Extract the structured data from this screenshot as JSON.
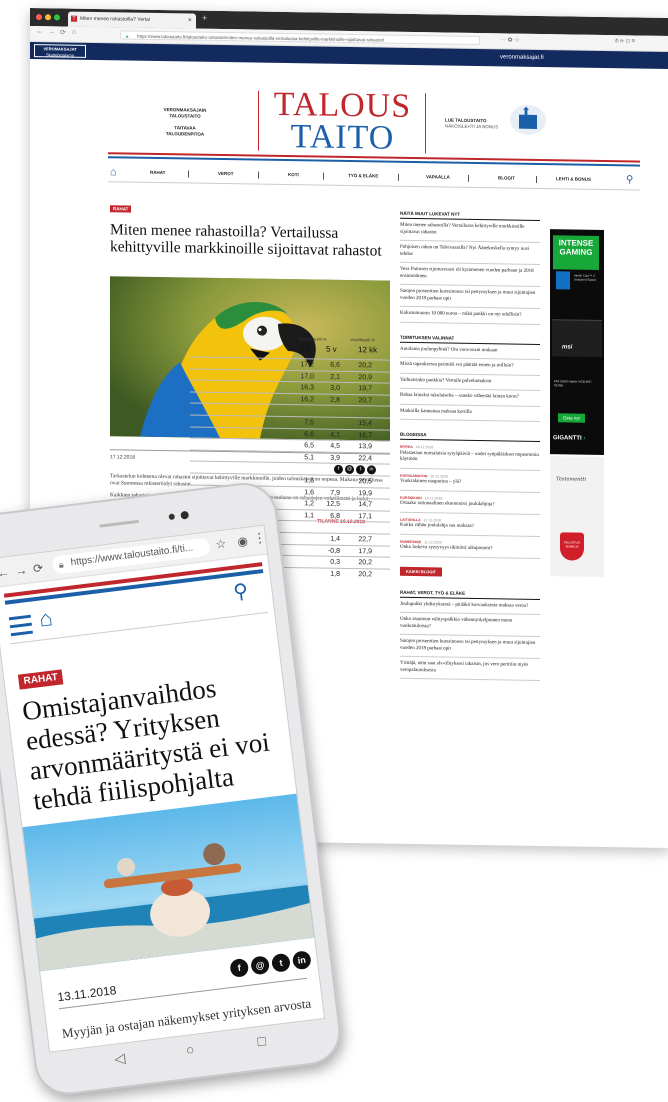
{
  "browser": {
    "tab_title": "Miten menee rahastoilla? Vertai",
    "url": "https://www.taloustaito.fi/taloustaito-rahastot/miten-menee-rahastoilla-vertailussa-kehittyville-markkinoille-sijoittavat-rahastot/",
    "new_tab": "+",
    "url_actions": "··· ✿ ☆",
    "toolbar_right": "⫛ ⊪ ⊡ ≡"
  },
  "site": {
    "topbar_logo_line1": "VEROMAKSAJAT",
    "topbar_logo_line2": "Skattebetalarna",
    "topbar_link": "veronmaksajat.fi",
    "masthead_left": [
      "VERONMAKSAJAIN",
      "TALOUSTAITO",
      "TAITAVAA",
      "TALOUDENPITOA"
    ],
    "logo_line1": "TALOUS",
    "logo_line2": "TAITO",
    "masthead_right_title": "LUE TALOUSTAITO",
    "masthead_right_sub": "NÄKÖISLEHTI JA BONUS",
    "nav": [
      "RAHAT",
      "VEROT",
      "KOTI",
      "TYÖ & ELÄKE",
      "VAPAALLA",
      "BLOGIT",
      "LEHTI & BONUS"
    ]
  },
  "article": {
    "badge": "RAHAT",
    "title": "Miten menee rahastoilla? Vertailussa kehittyville markkinoille sijoittavat rahastot",
    "date": "17.12.2018",
    "lead1": "Tarkastelun kohteena olevat rahastot sijoittavat kehittyville markkinoille, joiden talouskasvu on nopeaa. Mukana vertailussa ovat Suomessa rekisteröidyt rahastot.",
    "lead2": "Kaikkien rahastojen tuotot näkyvät taulukossa samalta aikaväliltä. Lisäksi mukana on rahastojen volatiliteetti ja kulut.",
    "table_heading": "TILANNE 10.12.2018",
    "th_return": "Muutosvauhti %",
    "th_vol": "Volatiliteetti %",
    "cols": [
      "3 v",
      "5 v",
      "12 kk"
    ],
    "rows": [
      [
        "17,2",
        "6,6",
        "20,2"
      ],
      [
        "17,0",
        "2,1",
        "20,9"
      ],
      [
        "16,3",
        "3,0",
        "19,7"
      ],
      [
        "16,2",
        "2,8",
        "20,7"
      ],
      [
        "",
        "",
        ""
      ],
      [
        "7,5",
        "",
        "15,4"
      ],
      [
        "6,6",
        "4,1",
        "16,7"
      ],
      [
        "6,5",
        "4,5",
        "13,9"
      ],
      [
        "5,1",
        "3,9",
        "22,4"
      ],
      [
        "",
        "",
        ""
      ],
      [
        "1,8",
        "",
        "20,5"
      ],
      [
        "1,6",
        "7,9",
        "19,9"
      ],
      [
        "1,2",
        "12,5",
        "14,7"
      ],
      [
        "1,1",
        "6,8",
        "17,1"
      ],
      [
        "",
        "",
        ""
      ],
      [
        "",
        "1,4",
        "22,7"
      ],
      [
        "",
        "-0,8",
        "17,9"
      ],
      [
        "",
        "0,3",
        "20,2"
      ],
      [
        "",
        "1,8",
        "20,2"
      ]
    ]
  },
  "sidebar": {
    "head1": "NÄITÄ MUUT LUKEVAT NYT",
    "most_read": [
      "Miten menee rahastoilla? Vertailussa kehittyville markkinoille sijoittavat rahastot",
      "Pohjoisen rahan on Talvivaaralla? Nyt Äänekoskella syntyy uusi tehdas",
      "Vesa Puttosen sijoitusvuosi oli kymmenen vuoden parhaan ja 2018 ensimmäinen",
      "Satojen prosenttien kurssinousu tai pettymyksen ja muut sijoittajien vuoden 2018 parhaat opit",
      "Kalustomuutto 10 000 euroa – mikä pankki on nyt edullisin?"
    ],
    "head2": "TOIMITUKSEN VALINNAT",
    "picks": [
      "Autolaina joulunpyhinä? Ota vara-avain mukaan",
      "Missä tapauksessa perintöä voi päättää ennen ja milloin?",
      "Vaihtaisinko pankkia? Vertaile palvelumaksut",
      "Rahaa lainaksi tukulaiselta – saanko vähentää lainan korot?",
      "Matkoilla kannattaa maksaa kortilla"
    ],
    "head3": "BLOGEISSA",
    "blogs": [
      {
        "cat": "MYRKA",
        "date": "20.12.2018",
        "title": "Pelastetaan nuosalaisia sytyäpäiviä – uudet syöpäläiskset nopeammin käyttöön"
      },
      {
        "cat": "KORVAAMATON",
        "date": "18.12.2018",
        "title": "Vuokralainen naapurina – ylä?"
      },
      {
        "cat": "KURSSIKAIN",
        "date": "14.12.2018",
        "title": "Ostaako rationaalinen ekonomisti joululahjoja?"
      },
      {
        "cat": "LAITURILLA",
        "date": "12.12.2018",
        "title": "Kaitka vähän joululahja saa maksaa?"
      },
      {
        "cat": "NUMEROISE",
        "date": "11.12.2018",
        "title": "Onko laskeva syntyvyys tikittävä aikapommi?"
      }
    ],
    "blogs_button": "KAIKKI BLOGIT",
    "head4": "RAHAT, VEROT, TYÖ & ELÄKE",
    "latest": [
      "Joulupukki yhdistyksestä – pitääkö korvauksesta maksaa veroa?",
      "Onko asuntoon välityspalkkio vähennyskelpoinen meno vuokratuloista?",
      "Satojen prosenttien kurssinousu tai pettymyksen ja muut sijoittajien vuoden 2018 parhaat opit",
      "Yrittäjä, näin saat alv-tilityksesi takaisin, jos vero perittiin myös veropalautuksesta"
    ]
  },
  "ads": {
    "intel_line1": "INTENSE",
    "intel_line2": "GAMING",
    "intel_small": "Intel® Core™ i7 Unlocked Suited",
    "msi": "msi",
    "msi_desc": "MSI GE63 Raider RGB 8RF-015NE",
    "cta": "Osta nyt",
    "gigantti": "GIGANTTI",
    "salvation_sig": "Testamentti",
    "salvation_text": "PELASTUS ARMEIJA"
  },
  "phone": {
    "url": "https://www.taloustaito.fi/ti...",
    "badge": "RAHAT",
    "title": "Omistajanvaihdos edessä? Yrityksen arvonmääritystä ei voi tehdä fiilispohjalta",
    "date": "13.11.2018",
    "lead": "Myyjän ja ostajan näkemykset yrityksen arvosta"
  },
  "colors": {
    "brand_red": "#c0272d",
    "brand_blue": "#1b5fa8",
    "top_navy": "#132a5e",
    "ad_green": "#18a83a"
  },
  "icons": [
    "home-icon",
    "search-icon",
    "hamburger-icon",
    "lock-icon",
    "facebook-icon",
    "email-icon",
    "twitter-icon",
    "linkedin-icon",
    "back-icon",
    "forward-icon",
    "reload-icon",
    "star-icon",
    "more-icon"
  ]
}
